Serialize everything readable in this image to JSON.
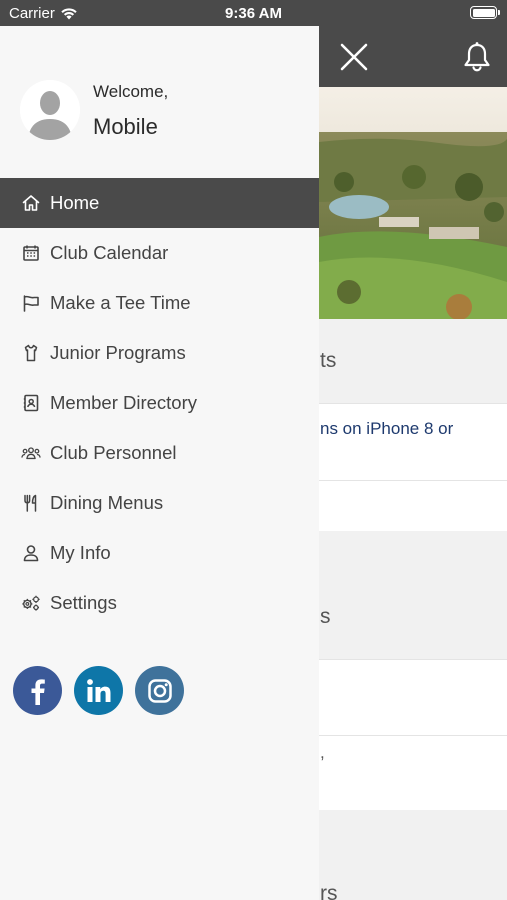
{
  "status_bar": {
    "carrier": "Carrier",
    "time": "9:36 AM"
  },
  "drawer": {
    "welcome": "Welcome,",
    "username": "Mobile",
    "menu": [
      {
        "label": "Home",
        "icon": "home-icon",
        "active": true
      },
      {
        "label": "Club Calendar",
        "icon": "calendar-icon"
      },
      {
        "label": "Make a Tee Time",
        "icon": "flag-icon"
      },
      {
        "label": "Junior Programs",
        "icon": "shirt-icon"
      },
      {
        "label": "Member Directory",
        "icon": "contact-book-icon"
      },
      {
        "label": "Club Personnel",
        "icon": "people-icon"
      },
      {
        "label": "Dining Menus",
        "icon": "utensils-icon"
      },
      {
        "label": "My Info",
        "icon": "user-icon"
      },
      {
        "label": "Settings",
        "icon": "gears-icon"
      }
    ],
    "social": [
      {
        "name": "facebook",
        "color": "#3b5998",
        "glyph": "f"
      },
      {
        "name": "linkedin",
        "color": "#0e76a8",
        "glyph": "in"
      },
      {
        "name": "instagram",
        "color": "#3f729b",
        "glyph": ""
      }
    ]
  },
  "background": {
    "section1_title": "ts",
    "section1_link": "ns on iPhone 8 or",
    "section2_title": "s",
    "section2_mark": ",",
    "section3_title": "rs"
  }
}
